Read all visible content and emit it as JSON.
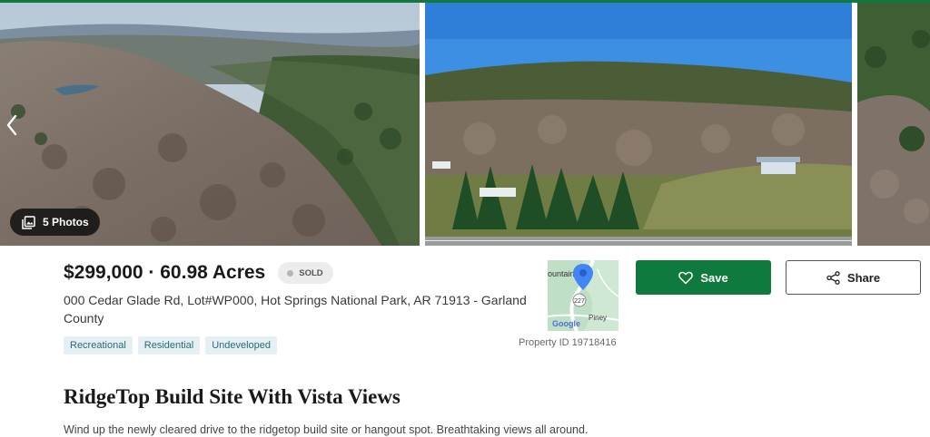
{
  "colors": {
    "brand_green": "#0f7a3d",
    "tag_bg": "#e4f0f3",
    "tag_text": "#2b6a77",
    "sold_dot": "#b5b5b5"
  },
  "gallery": {
    "photo_count_label": "5 Photos",
    "prev_icon": "chevron-left-icon",
    "photos_icon": "photo-stack-icon"
  },
  "listing": {
    "price_line": "$299,000 · 60.98 Acres",
    "status": "SOLD",
    "address": "000 Cedar Glade Rd, Lot#WP000, Hot Springs National Park, AR 71913 - Garland County",
    "tags": [
      "Recreational",
      "Residential",
      "Undeveloped"
    ],
    "property_id": "Property ID 19718416",
    "title": "RidgeTop Build Site With Vista Views",
    "description": "Wind up the newly cleared drive to the ridgetop build site or hangout spot. Breathtaking views all around."
  },
  "map": {
    "place_label": "ountain",
    "road_label": "227",
    "town_label": "Piney",
    "provider": "Google"
  },
  "actions": {
    "save_label": "Save",
    "save_icon": "heart-icon",
    "share_label": "Share",
    "share_icon": "share-icon"
  }
}
